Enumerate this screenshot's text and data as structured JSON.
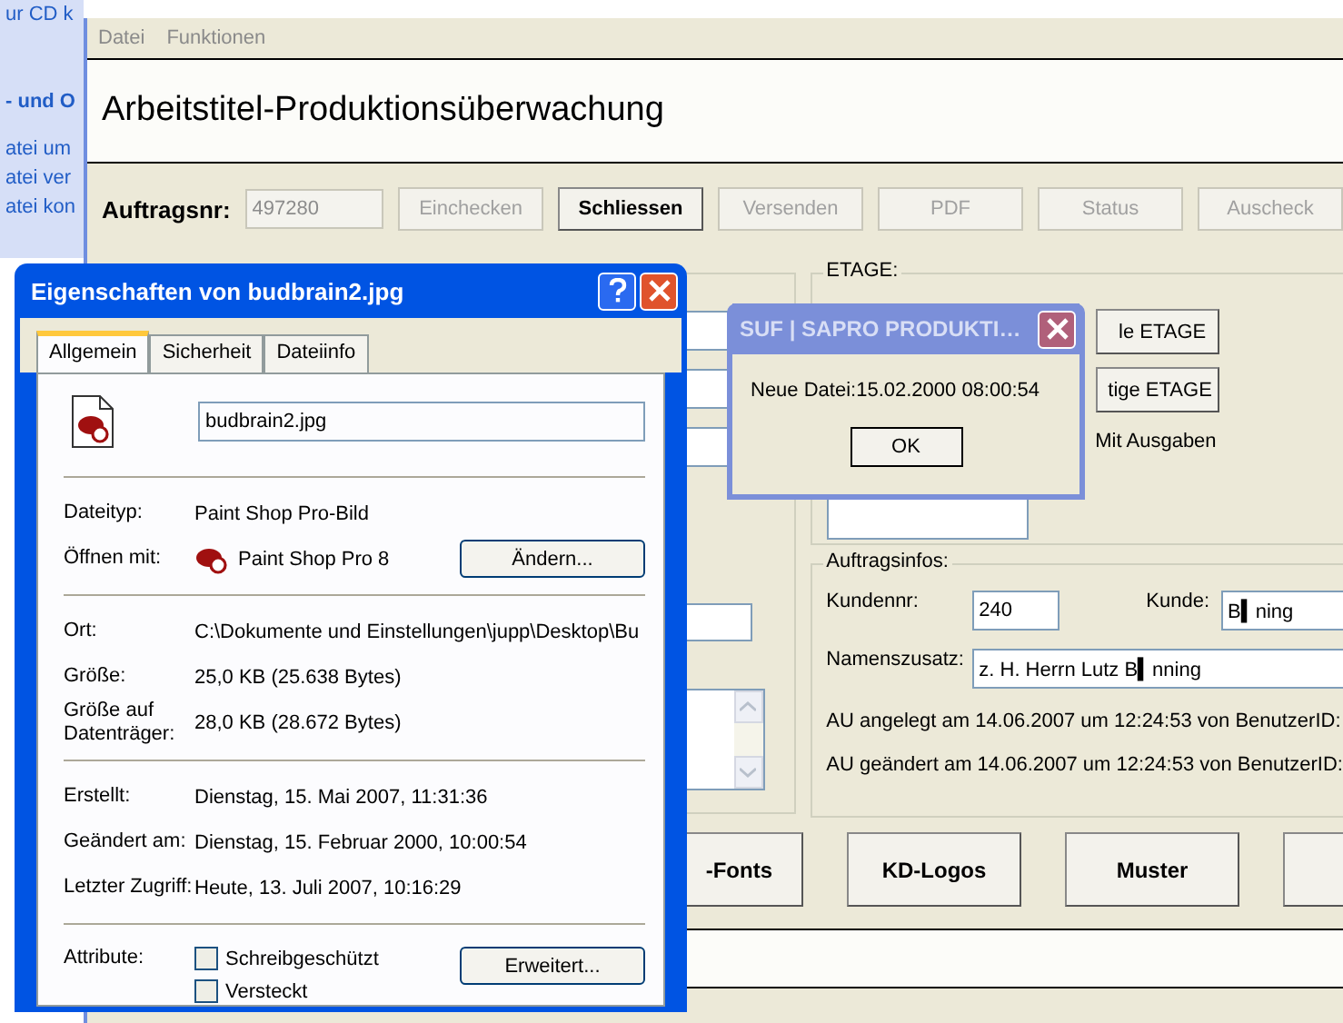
{
  "background_window": {
    "lines": [
      "ur CD k",
      "- und O",
      "atei um",
      "atei ver",
      "atei kon"
    ]
  },
  "main_window": {
    "menu": [
      "Datei",
      "Funktionen"
    ],
    "heading": "Arbeitstitel-Produktionsüberwachung",
    "order_label": "Auftragsnr:",
    "order_field": {
      "value": "497280",
      "disabled": true
    },
    "toolbar_buttons": [
      {
        "label": "Einchecken",
        "disabled": true
      },
      {
        "label": "Schliessen",
        "disabled": false
      },
      {
        "label": "Versenden",
        "disabled": true
      },
      {
        "label": "PDF",
        "disabled": true
      },
      {
        "label": "Status",
        "disabled": true
      },
      {
        "label": "Auscheck",
        "disabled": true
      }
    ],
    "etage": {
      "title": "ETAGE:",
      "buttons": [
        "le ETAGE",
        "tige ETAGE"
      ],
      "option": "Mit Ausgaben"
    },
    "order_info": {
      "title": "Auftragsinfos:",
      "customer_no_label": "Kundennr:",
      "customer_no": "240",
      "customer_label": "Kunde:",
      "customer": "B▍ning",
      "name_suffix_label": "Namenszusatz:",
      "name_suffix": "z. H. Herrn Lutz B▍nning",
      "created": "AU angelegt am 14.06.2007 um 12:24:53 von BenutzerID:",
      "changed": "AU geändert am 14.06.2007 um 12:24:53 von BenutzerID:"
    },
    "bottom_buttons": [
      "-Fonts",
      "KD-Logos",
      "Muster"
    ]
  },
  "properties_dialog": {
    "title": "Eigenschaften von budbrain2.jpg",
    "tabs": [
      {
        "label": "Allgemein",
        "selected": true
      },
      {
        "label": "Sicherheit",
        "selected": false
      },
      {
        "label": "Dateiinfo",
        "selected": false
      }
    ],
    "file_name": "budbrain2.jpg",
    "sections": [
      [
        {
          "kind": "text",
          "label": "Dateityp:",
          "value": "Paint Shop Pro-Bild"
        },
        {
          "kind": "app",
          "label": "Öffnen mit:",
          "value": "Paint Shop Pro 8",
          "button": "Ändern..."
        }
      ],
      [
        {
          "kind": "text",
          "label": "Ort:",
          "value": "C:\\Dokumente und Einstellungen\\jupp\\Desktop\\Bu"
        },
        {
          "kind": "text",
          "label": "Größe:",
          "value": "25,0 KB (25.638 Bytes)"
        },
        {
          "kind": "text",
          "label": "Größe auf Datenträger:",
          "value": "28,0 KB (28.672 Bytes)"
        }
      ],
      [
        {
          "kind": "text",
          "label": "Erstellt:",
          "value": "Dienstag, 15. Mai 2007, 11:31:36"
        },
        {
          "kind": "text",
          "label": "Geändert am:",
          "value": "Dienstag, 15. Februar 2000, 10:00:54"
        },
        {
          "kind": "text",
          "label": "Letzter Zugriff:",
          "value": "Heute, 13. Juli 2007, 10:16:29"
        }
      ]
    ],
    "attributes": {
      "label": "Attribute:",
      "checkboxes": [
        {
          "label": "Schreibgeschützt",
          "checked": false
        },
        {
          "label": "Versteckt",
          "checked": false
        }
      ],
      "button": "Erweitert..."
    }
  },
  "message_box": {
    "title": "SUF | SAPRO PRODUKTI…",
    "message": "Neue Datei:15.02.2000 08:00:54",
    "button": "OK"
  }
}
